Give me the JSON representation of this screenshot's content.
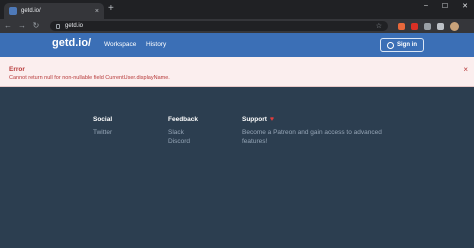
{
  "browser": {
    "tab_title": "getd.io/",
    "tab_close": "×",
    "new_tab": "+",
    "url": "getd.io",
    "window_controls": [
      "–",
      "☐",
      "✕"
    ]
  },
  "site": {
    "logo": "getd.io/",
    "nav": [
      "Workspace",
      "History"
    ],
    "signin_label": "Sign in"
  },
  "alert": {
    "title": "Error",
    "message": "Cannot return null for non-nullable field CurrentUser.displayName.",
    "close": "×"
  },
  "footer": {
    "social": {
      "heading": "Social",
      "links": [
        "Twitter"
      ]
    },
    "feedback": {
      "heading": "Feedback",
      "links": [
        "Slack",
        "Discord"
      ]
    },
    "support": {
      "heading": "Support",
      "text_lines": [
        "Become a Patreon and gain access to advanced",
        "features!"
      ]
    }
  },
  "colors": {
    "header": "#3b6fb6",
    "alert_bg": "#fbeeee",
    "alert_text": "#b73a3a",
    "page_bg": "#2c3e50"
  }
}
